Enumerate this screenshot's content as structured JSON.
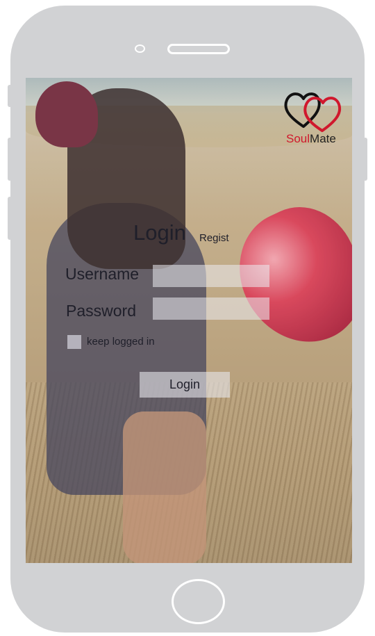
{
  "app": {
    "brand_part1": "Soul",
    "brand_part2": "Mate",
    "brand_color": "#d0182d"
  },
  "auth": {
    "title": "Login",
    "register_link": "Regist",
    "username_label": "Username",
    "username_value": "",
    "password_label": "Password",
    "password_value": "",
    "keep_logged_in_label": "keep logged in",
    "keep_logged_in_checked": false,
    "submit_label": "Login"
  },
  "icons": {
    "logo": "hearts-logo-icon"
  },
  "device": {
    "frame_color": "#d1d2d4"
  }
}
